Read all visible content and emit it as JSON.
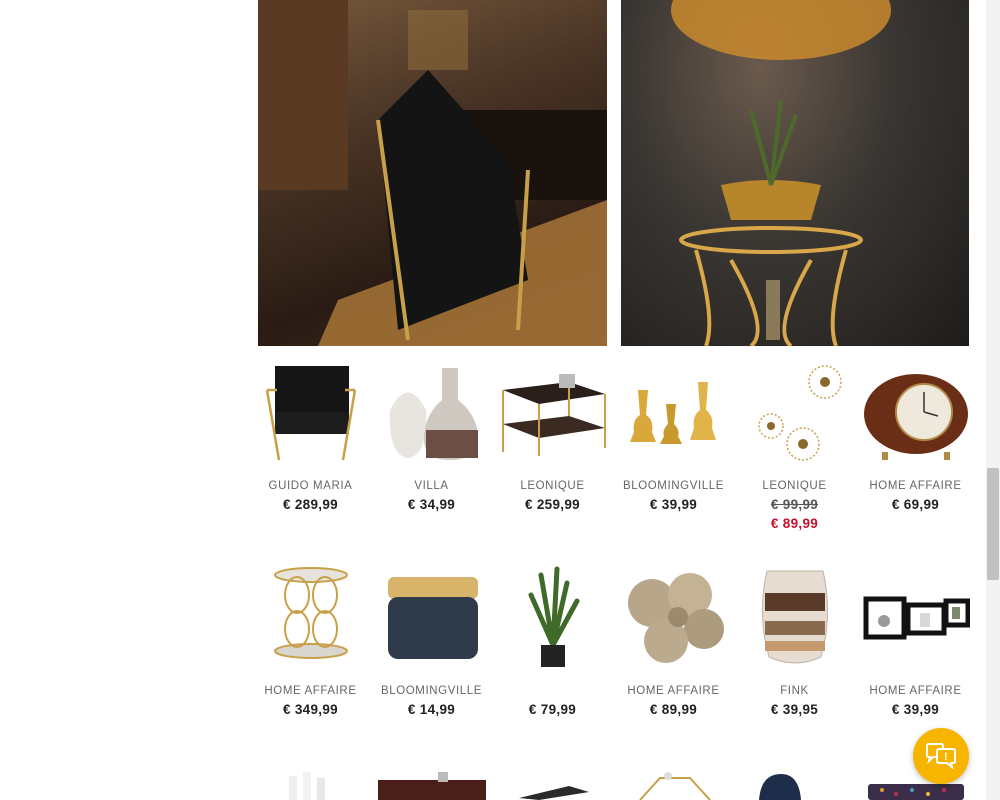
{
  "hero": {
    "left_alt": "",
    "right_alt": ""
  },
  "products": [
    {
      "brand": "GUIDO MARIA",
      "price": "€ 289,99"
    },
    {
      "brand": "VILLA",
      "price": "€ 34,99"
    },
    {
      "brand": "LEONIQUE",
      "price": "€ 259,99"
    },
    {
      "brand": "BLOOMINGVILLE",
      "price": "€ 39,99"
    },
    {
      "brand": "LEONIQUE",
      "price_old": "€ 99,99",
      "price": "€ 89,99"
    },
    {
      "brand": "HOME AFFAIRE",
      "price": "€ 69,99"
    },
    {
      "brand": "HOME AFFAIRE",
      "price": "€ 349,99"
    },
    {
      "brand": "BLOOMINGVILLE",
      "price": "€ 14,99"
    },
    {
      "brand": "",
      "price": "€ 79,99"
    },
    {
      "brand": "HOME AFFAIRE",
      "price": "€ 89,99"
    },
    {
      "brand": "FINK",
      "price": "€ 39,95"
    },
    {
      "brand": "HOME AFFAIRE",
      "price": "€ 39,99"
    }
  ],
  "colors": {
    "sale": "#c8102e",
    "chat": "#f7b500"
  },
  "icons": {
    "chat": "chat-bubbles-icon"
  }
}
